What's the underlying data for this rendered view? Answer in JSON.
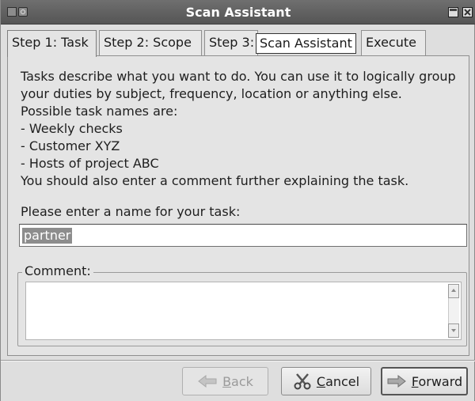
{
  "window": {
    "title": "Scan Assistant"
  },
  "tabs": [
    {
      "label": "Step 1: Task",
      "active": true
    },
    {
      "label": "Step 2: Scope",
      "active": false
    },
    {
      "label": "Step 3:",
      "active": false
    },
    {
      "label": "Execute",
      "active": false
    }
  ],
  "tooltip": {
    "text": "Scan Assistant"
  },
  "description": {
    "lines": [
      "Tasks describe what you want to do. You can use it to logically group",
      "your duties by subject, frequency, location or anything else.",
      "Possible task names are:",
      " - Weekly checks",
      " - Customer XYZ",
      " - Hosts of project ABC",
      "You should also enter a comment further explaining the task."
    ]
  },
  "name_field": {
    "label": "Please enter a name for your task:",
    "value": "partner"
  },
  "comment": {
    "label": "Comment:",
    "value": ""
  },
  "buttons": {
    "back": {
      "mnemonic": "B",
      "rest": "ack",
      "enabled": false
    },
    "cancel": {
      "mnemonic": "C",
      "rest": "ancel",
      "enabled": true
    },
    "forward": {
      "mnemonic": "F",
      "rest": "orward",
      "enabled": true
    }
  },
  "icons": {
    "back": "arrow-left-icon",
    "cancel": "scissors-icon",
    "forward": "arrow-right-icon"
  }
}
